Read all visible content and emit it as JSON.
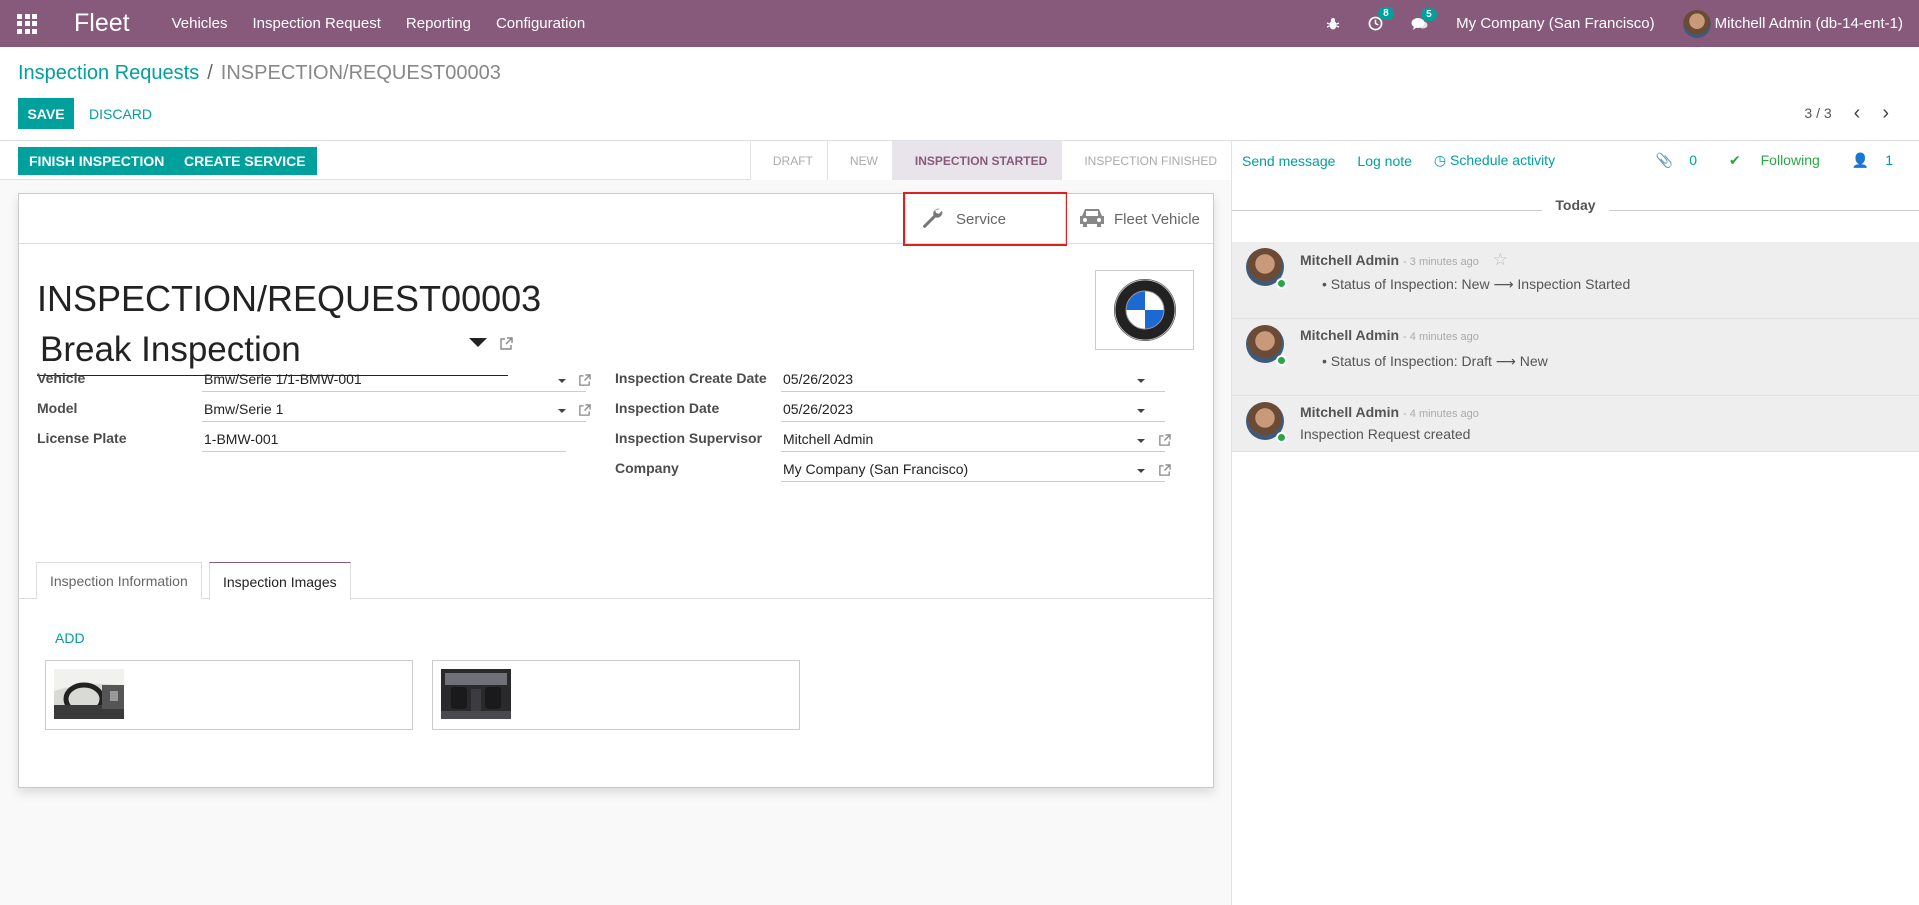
{
  "navbar": {
    "brand": "Fleet",
    "menu": [
      "Vehicles",
      "Inspection Request",
      "Reporting",
      "Configuration"
    ],
    "activity_count": "8",
    "message_count": "5",
    "company": "My Company (San Francisco)",
    "user": "Mitchell Admin (db-14-ent-1)"
  },
  "breadcrumb": {
    "parent": "Inspection Requests",
    "separator": "/",
    "current": "INSPECTION/REQUEST00003"
  },
  "actions": {
    "save": "SAVE",
    "discard": "DISCARD"
  },
  "pager": {
    "value": "3 / 3"
  },
  "statusbar": {
    "buttons": [
      "FINISH INSPECTION",
      "CREATE SERVICE"
    ],
    "stages": [
      "DRAFT",
      "NEW",
      "INSPECTION STARTED",
      "INSPECTION FINISHED"
    ],
    "active_stage": "INSPECTION STARTED"
  },
  "smart_buttons": {
    "service": "Service",
    "fleet_vehicle": "Fleet Vehicle"
  },
  "record": {
    "name": "INSPECTION/REQUEST00003",
    "inspection_type": "Break Inspection"
  },
  "fields": {
    "vehicle": {
      "label": "Vehicle",
      "value": "Bmw/Serie 1/1-BMW-001"
    },
    "model": {
      "label": "Model",
      "value": "Bmw/Serie 1"
    },
    "license_plate": {
      "label": "License Plate",
      "value": "1-BMW-001"
    },
    "create_date": {
      "label": "Inspection Create Date",
      "value": "05/26/2023"
    },
    "inspection_date": {
      "label": "Inspection Date",
      "value": "05/26/2023"
    },
    "supervisor": {
      "label": "Inspection Supervisor",
      "value": "Mitchell Admin"
    },
    "company": {
      "label": "Company",
      "value": "My Company (San Francisco)"
    }
  },
  "tabs": [
    "Inspection Information",
    "Inspection Images"
  ],
  "active_tab": "Inspection Images",
  "images": {
    "add": "ADD"
  },
  "chatter": {
    "send_message": "Send message",
    "log_note": "Log note",
    "schedule_activity": "Schedule activity",
    "attachments": "0",
    "following": "Following",
    "followers": "1",
    "today": "Today",
    "messages": [
      {
        "author": "Mitchell Admin",
        "time": "- 3 minutes ago",
        "body": "Status of Inspection: New ⟶ Inspection Started"
      },
      {
        "author": "Mitchell Admin",
        "time": "- 4 minutes ago",
        "body": "Status of Inspection: Draft ⟶ New"
      },
      {
        "author": "Mitchell Admin",
        "time": "- 4 minutes ago",
        "body": "Inspection Request created"
      }
    ]
  },
  "colors": {
    "brand": "#875a7b",
    "accent": "#00a09d",
    "highlight_box": "#e02020"
  }
}
